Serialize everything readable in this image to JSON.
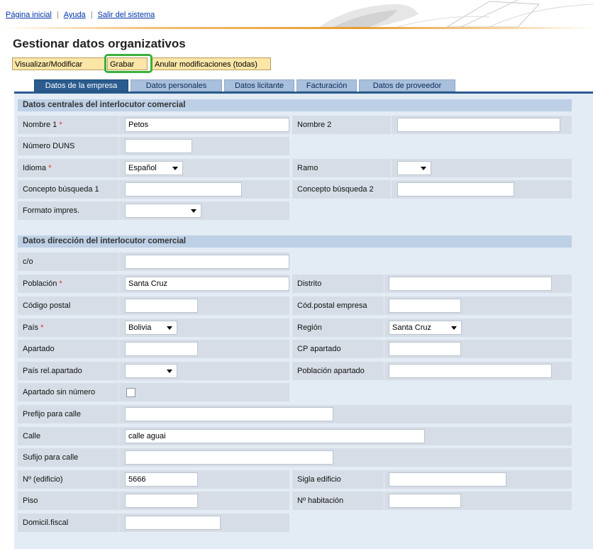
{
  "toplinks": {
    "home": "Página inicial",
    "help": "Ayuda",
    "logout": "Salir del sistema"
  },
  "title": "Gestionar datos organizativos",
  "buttons": {
    "view_modify": "Visualizar/Modificar",
    "save": "Grabar",
    "cancel_all": "Anular modificaciones (todas)"
  },
  "tabs": [
    "Datos de la empresa",
    "Datos personales",
    "Datos licitante",
    "Facturación",
    "Datos de proveedor"
  ],
  "section1": {
    "title": "Datos centrales del interlocutor comercial",
    "nombre1_label": "Nombre 1",
    "nombre1_value": "Petos",
    "nombre2_label": "Nombre 2",
    "nombre2_value": "",
    "duns_label": "Número DUNS",
    "duns_value": "",
    "idioma_label": "Idioma",
    "idioma_value": "Español",
    "ramo_label": "Ramo",
    "ramo_value": "",
    "concepto1_label": "Concepto búsqueda 1",
    "concepto1_value": "",
    "concepto2_label": "Concepto búsqueda 2",
    "concepto2_value": "",
    "formato_label": "Formato impres.",
    "formato_value": ""
  },
  "section2": {
    "title": "Datos dirección del interlocutor comercial",
    "co_label": "c/o",
    "co_value": "",
    "poblacion_label": "Población",
    "poblacion_value": "Santa Cruz",
    "distrito_label": "Distrito",
    "distrito_value": "",
    "cp_label": "Código postal",
    "cp_value": "",
    "cp_empresa_label": "Cód.postal empresa",
    "cp_empresa_value": "",
    "pais_label": "País",
    "pais_value": "Bolivia",
    "region_label": "Región",
    "region_value": "Santa Cruz",
    "apartado_label": "Apartado",
    "apartado_value": "",
    "cp_apartado_label": "CP apartado",
    "cp_apartado_value": "",
    "pais_rel_label": "País rel.apartado",
    "pais_rel_value": "",
    "poblacion_apartado_label": "Población apartado",
    "poblacion_apartado_value": "",
    "apartado_sin_numero_label": "Apartado sin número",
    "prefijo_label": "Prefijo para calle",
    "prefijo_value": "",
    "calle_label": "Calle",
    "calle_value": "calle aguai",
    "sufijo_label": "Sufijo para calle",
    "sufijo_value": "",
    "num_edificio_label": "Nº (edificio)",
    "num_edificio_value": "5666",
    "sigla_label": "Sigla edificio",
    "sigla_value": "",
    "piso_label": "Piso",
    "piso_value": "",
    "habitacion_label": "Nº habitación",
    "habitacion_value": "",
    "domicil_label": "Domicil.fiscal",
    "domicil_value": ""
  },
  "required_mark": "*",
  "colors": {
    "tab_active": "#2b5c8f",
    "button_bg": "#fbe6a7",
    "highlight": "#3ab03a",
    "panel": "#e3ebf4",
    "required": "#e03030"
  }
}
